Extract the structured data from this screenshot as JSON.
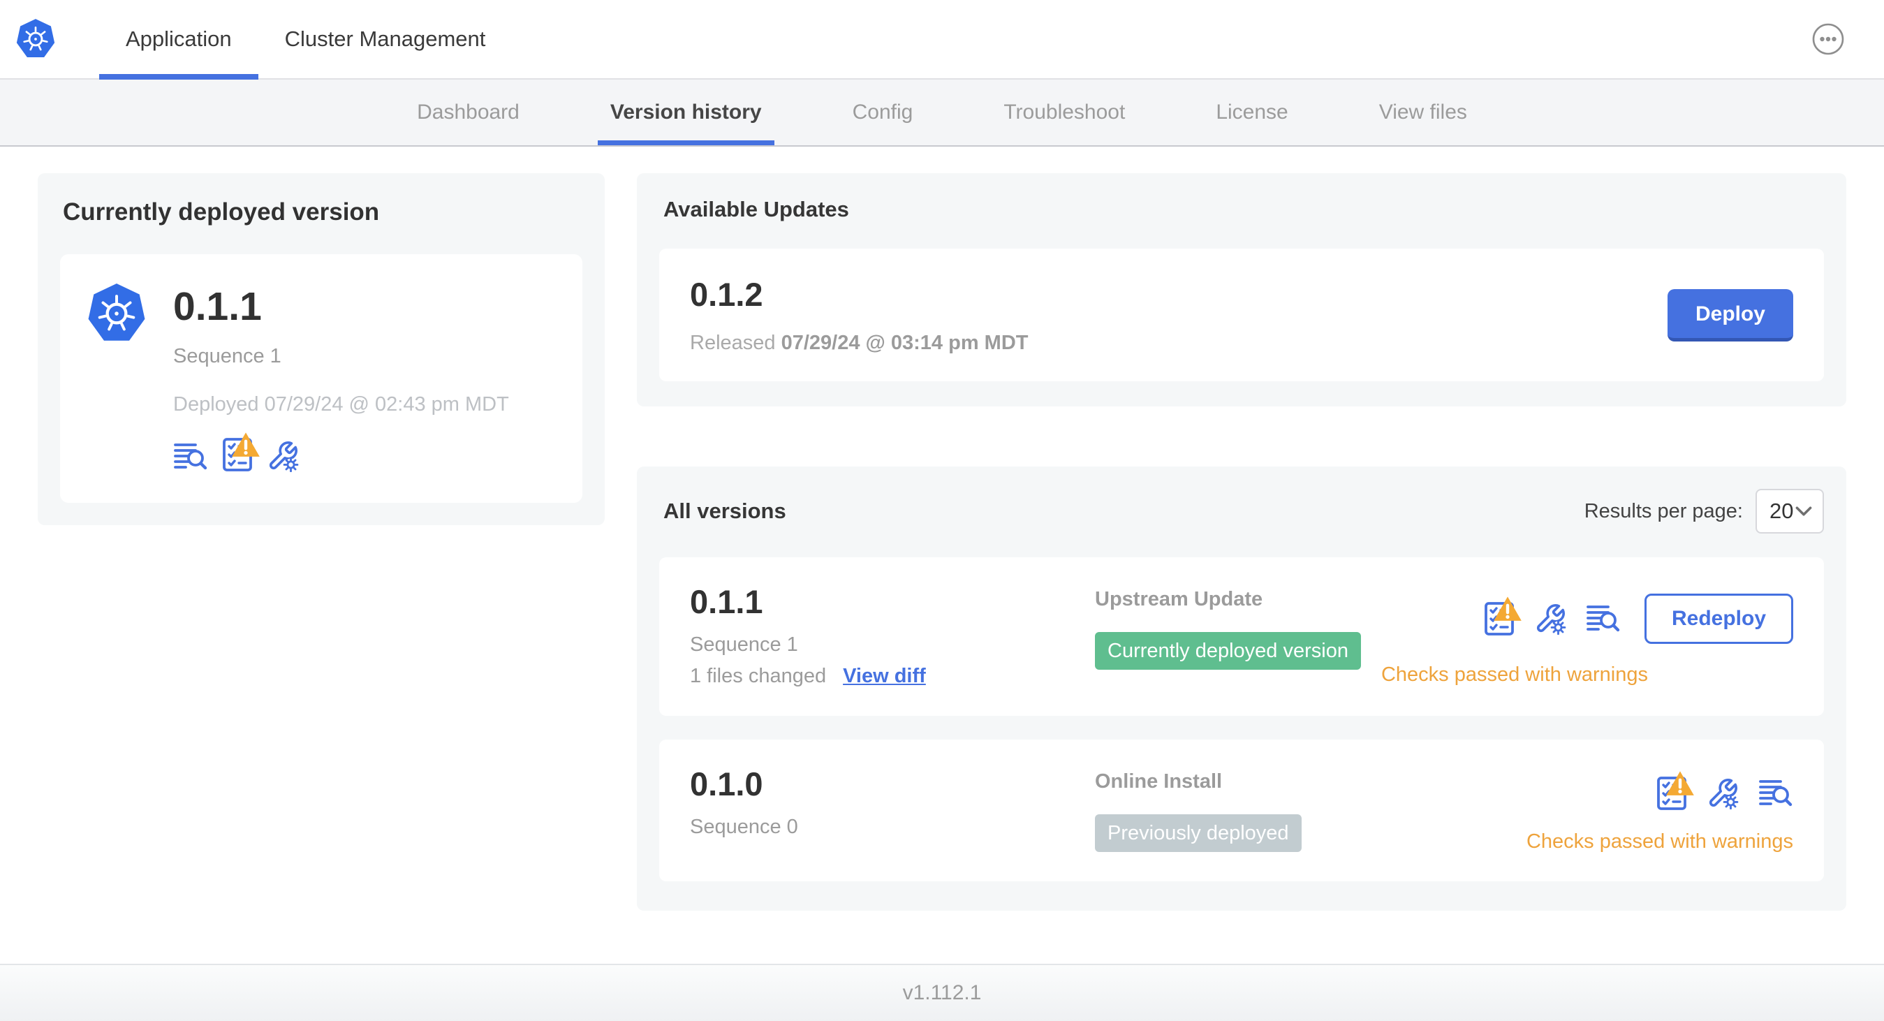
{
  "colors": {
    "accent_blue": "#4571E0",
    "k8s_logo_blue": "#326DE6",
    "success_green": "#5FBE8F",
    "muted_badge_gray": "#C2CCD0",
    "warning_amber": "#EEA33C"
  },
  "header": {
    "logo_icon": "kubernetes-logo-icon",
    "tabs": [
      {
        "label": "Application",
        "active": true
      },
      {
        "label": "Cluster Management",
        "active": false
      }
    ],
    "menu_icon": "ellipsis-menu-icon"
  },
  "nav": {
    "tabs": [
      {
        "label": "Dashboard",
        "active": false
      },
      {
        "label": "Version history",
        "active": true
      },
      {
        "label": "Config",
        "active": false
      },
      {
        "label": "Troubleshoot",
        "active": false
      },
      {
        "label": "License",
        "active": false
      },
      {
        "label": "View files",
        "active": false
      }
    ]
  },
  "deployed_card": {
    "title": "Currently deployed version",
    "app_icon": "kubernetes-logo-icon",
    "version": "0.1.1",
    "sequence": "Sequence 1",
    "deployed_at": "Deployed 07/29/24 @ 02:43 pm MDT",
    "icons": [
      "release-notes-icon",
      "preflight-checks-warning-icon",
      "config-icon"
    ]
  },
  "available_updates": {
    "title": "Available Updates",
    "version": "0.1.2",
    "released_label": "Released",
    "released_date": "07/29/24 @ 03:14 pm MDT",
    "deploy_label": "Deploy"
  },
  "all_versions": {
    "title": "All versions",
    "results_per_page_label": "Results per page:",
    "results_per_page_value": "20",
    "rows": [
      {
        "version": "0.1.1",
        "sequence": "Sequence 1",
        "files_changed": "1 files changed",
        "view_diff_label": "View diff",
        "source": "Upstream Update",
        "badge": "Currently deployed version",
        "badge_type": "success",
        "icons": [
          "preflight-checks-warning-icon",
          "config-icon",
          "release-notes-icon"
        ],
        "status": "Checks passed with warnings",
        "action_label": "Redeploy"
      },
      {
        "version": "0.1.0",
        "sequence": "Sequence 0",
        "source": "Online Install",
        "badge": "Previously deployed",
        "badge_type": "muted",
        "icons": [
          "preflight-checks-warning-icon",
          "config-icon",
          "release-notes-icon"
        ],
        "status": "Checks passed with warnings"
      }
    ]
  },
  "footer": {
    "version": "v1.112.1"
  }
}
